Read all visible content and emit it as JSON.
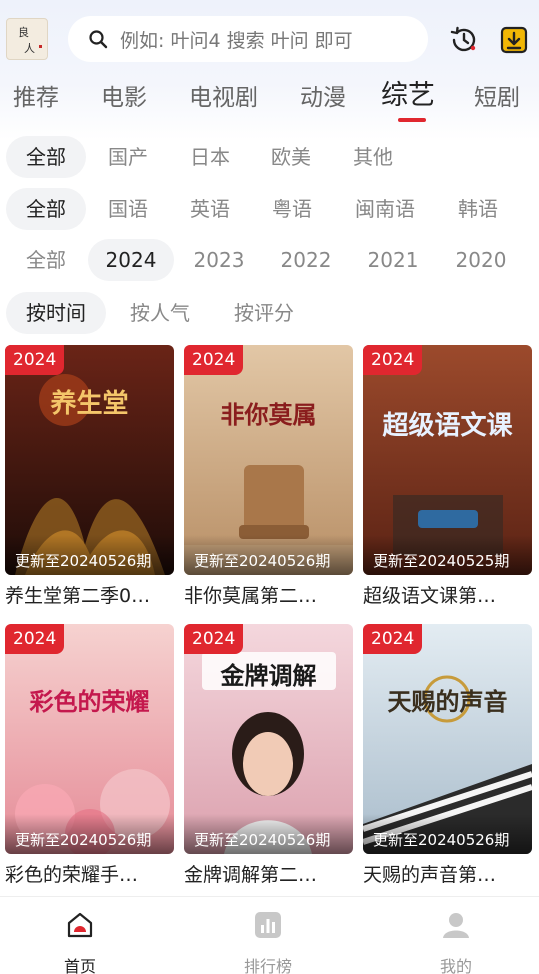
{
  "header": {
    "logo_text": "良人",
    "search_placeholder": "例如: 叶问4 搜索 叶问 即可",
    "history_icon": "history-icon",
    "download_icon": "download-icon"
  },
  "categories": [
    "推荐",
    "电影",
    "电视剧",
    "动漫",
    "综艺",
    "短剧"
  ],
  "active_category": "综艺",
  "filters": {
    "region": {
      "options": [
        "全部",
        "国产",
        "日本",
        "欧美",
        "其他"
      ],
      "selected": "全部"
    },
    "language": {
      "options": [
        "全部",
        "国语",
        "英语",
        "粤语",
        "闽南语",
        "韩语"
      ],
      "selected": "全部"
    },
    "year": {
      "options": [
        "全部",
        "2024",
        "2023",
        "2022",
        "2021",
        "2020"
      ],
      "selected": "2024"
    },
    "sort": {
      "options": [
        "按时间",
        "按人气",
        "按评分"
      ],
      "selected": "按时间"
    }
  },
  "shows": [
    {
      "year": "2024",
      "update": "更新至20240526期",
      "title": "养生堂第二季0…",
      "poster_text": "养生堂",
      "color": "#5a1d14"
    },
    {
      "year": "2024",
      "update": "更新至20240526期",
      "title": "非你莫属第二…",
      "poster_text": "非你莫属",
      "color": "#d8b58f"
    },
    {
      "year": "2024",
      "update": "更新至20240525期",
      "title": "超级语文课第…",
      "poster_text": "超级语文课",
      "color": "#8c3a24"
    },
    {
      "year": "2024",
      "update": "更新至20240526期",
      "title": "彩色的荣耀手…",
      "poster_text": "彩色的荣耀",
      "color": "#f0b8bf"
    },
    {
      "year": "2024",
      "update": "更新至20240526期",
      "title": "金牌调解第二…",
      "poster_text": "金牌调解",
      "color": "#e7a9b6"
    },
    {
      "year": "2024",
      "update": "更新至20240526期",
      "title": "天赐的声音第…",
      "poster_text": "天赐的声音",
      "color": "#cfdbe3"
    }
  ],
  "bottom_nav": [
    {
      "label": "首页",
      "icon": "home-icon",
      "active": true
    },
    {
      "label": "排行榜",
      "icon": "chart-icon",
      "active": false
    },
    {
      "label": "我的",
      "icon": "user-icon",
      "active": false
    }
  ],
  "colors": {
    "accent": "#e0272f"
  }
}
